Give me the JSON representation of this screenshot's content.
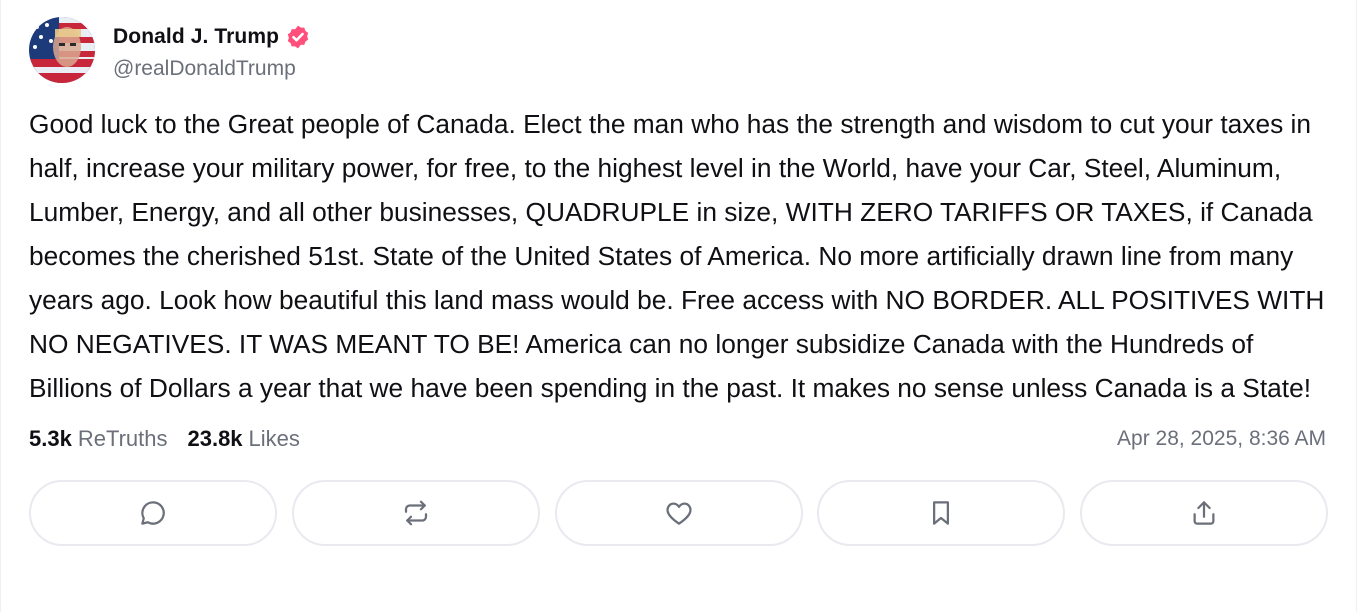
{
  "author": {
    "display_name": "Donald J. Trump",
    "handle": "@realDonaldTrump",
    "verified": true,
    "verified_color": "#ff4f7a",
    "avatar_icon": "avatar-portrait-flag"
  },
  "post": {
    "text": "Good luck to the Great people of Canada. Elect the man who has the strength and wisdom to cut your taxes in half, increase your military power, for free, to the highest level in the World, have your Car, Steel, Aluminum, Lumber, Energy, and all other businesses, QUADRUPLE in size, WITH ZERO TARIFFS OR TAXES, if Canada becomes the cherished 51st. State of the United States of America. No more artificially drawn line from many years ago. Look how beautiful this land mass would be. Free access with NO BORDER. ALL POSITIVES WITH NO NEGATIVES. IT WAS MEANT TO BE! America can no longer subsidize Canada with the Hundreds of Billions of Dollars a year that we have been spending in the past. It makes no sense unless Canada is a State!",
    "retruths_count": "5.3k",
    "retruths_label": "ReTruths",
    "likes_count": "23.8k",
    "likes_label": "Likes",
    "timestamp": "Apr 28, 2025, 8:36 AM"
  },
  "actions": [
    {
      "name": "reply",
      "icon": "comment-icon"
    },
    {
      "name": "retruth",
      "icon": "repost-icon"
    },
    {
      "name": "like",
      "icon": "heart-icon"
    },
    {
      "name": "bookmark",
      "icon": "bookmark-icon"
    },
    {
      "name": "share",
      "icon": "share-icon"
    }
  ],
  "colors": {
    "text": "#0f0f14",
    "muted": "#6b6f7a",
    "icon": "#6b6f7a",
    "border": "#e8eaef"
  }
}
